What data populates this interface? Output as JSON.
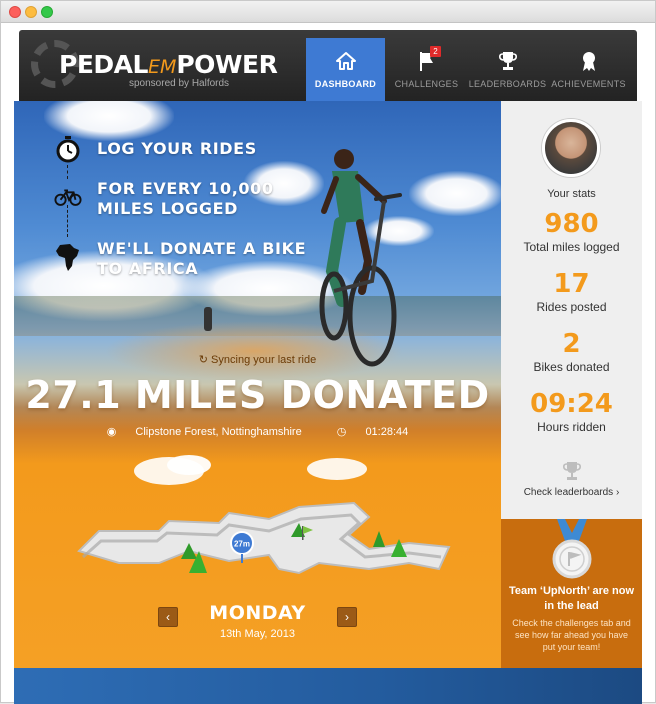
{
  "brand": {
    "name_part1": "PEDAL",
    "name_em": "EM",
    "name_part2": "POWER",
    "sponsor": "sponsored by Halfords"
  },
  "nav": [
    {
      "label": "DASHBOARD",
      "icon": "home-icon",
      "active": true
    },
    {
      "label": "CHALLENGES",
      "icon": "flag-icon",
      "badge": "2"
    },
    {
      "label": "LEADERBOARDS",
      "icon": "trophy-icon"
    },
    {
      "label": "ACHIEVEMENTS",
      "icon": "ribbon-icon"
    }
  ],
  "steps": [
    {
      "text": "LOG YOUR RIDES",
      "icon": "stopwatch-icon"
    },
    {
      "text": "FOR EVERY 10,000\nMILES LOGGED",
      "icon": "bicycle-icon"
    },
    {
      "text": "WE'LL DONATE A BIKE\nTO AFRICA",
      "icon": "africa-icon"
    }
  ],
  "ride": {
    "sync": "Syncing your last ride",
    "headline": "27.1 MILES DONATED",
    "location": "Clipstone Forest, Nottinghamshire",
    "duration": "01:28:44",
    "marker": "27m",
    "day": "MONDAY",
    "date": "13th May, 2013"
  },
  "stats": {
    "title": "Your stats",
    "items": [
      {
        "value": "980",
        "label": "Total miles logged"
      },
      {
        "value": "17",
        "label": "Rides posted"
      },
      {
        "value": "2",
        "label": "Bikes donated"
      },
      {
        "value": "09:24",
        "label": "Hours ridden"
      }
    ],
    "link": "Check leaderboards ›"
  },
  "team": {
    "title": "Team ‘UpNorth’ are now in the lead",
    "body": "Check the challenges tab and see how far ahead you have put your team!"
  },
  "colors": {
    "accent_orange": "#f39a1c",
    "nav_active": "#3e7ad3",
    "team_bg": "#c86d0e",
    "header_bg": "#2c2c2c"
  }
}
